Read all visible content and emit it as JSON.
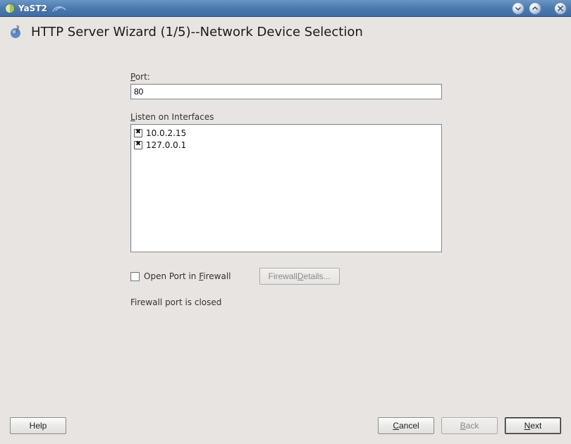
{
  "window": {
    "app_title": "YaST2"
  },
  "page": {
    "title": "HTTP Server Wizard (1/5)--Network Device Selection"
  },
  "port": {
    "label_pre": "P",
    "label_post": "ort:",
    "value": "80"
  },
  "interfaces": {
    "label_pre": "L",
    "label_post": "isten on Interfaces",
    "items": [
      {
        "label": "10.0.2.15",
        "checked": true
      },
      {
        "label": "127.0.0.1",
        "checked": true
      }
    ]
  },
  "firewall": {
    "checkbox_pre": "Open Port in ",
    "checkbox_accel": "F",
    "checkbox_post": "irewall",
    "checked": false,
    "details_pre": "Firewall ",
    "details_accel": "D",
    "details_post": "etails...",
    "status": "Firewall port is closed"
  },
  "footer": {
    "help": "Help",
    "cancel_accel": "C",
    "cancel_rest": "ancel",
    "back_accel": "B",
    "back_rest": "ack",
    "next_accel": "N",
    "next_rest": "ext"
  }
}
